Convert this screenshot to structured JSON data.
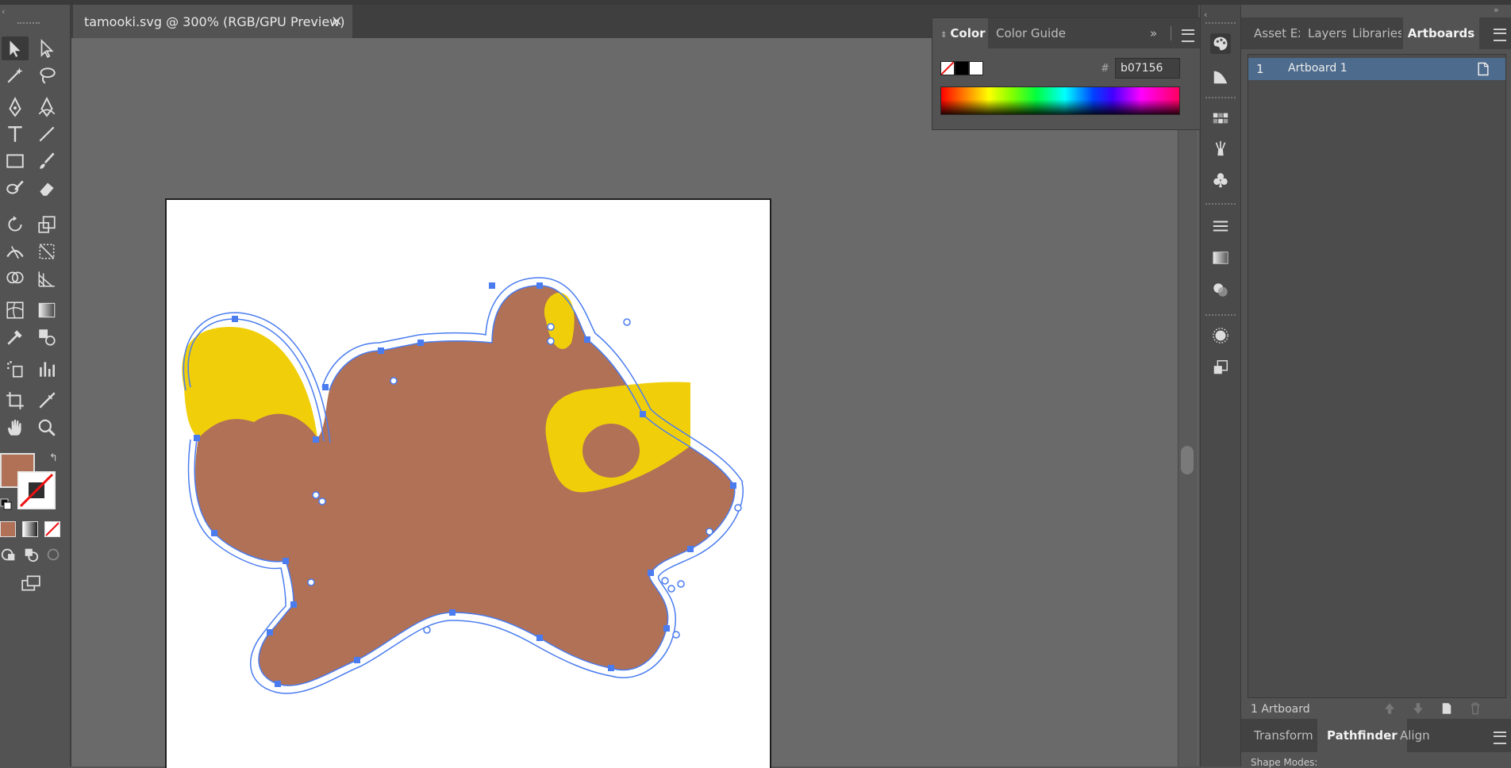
{
  "document": {
    "tab_title": "tamooki.svg @ 300% (RGB/GPU Preview)",
    "close_glyph": "×"
  },
  "color_panel": {
    "tabs": [
      "Color",
      "Color Guide"
    ],
    "hex_label": "#",
    "hex_value": "b07156",
    "expand_glyph": "»"
  },
  "right_panel": {
    "tabs": [
      "Asset Ex",
      "Layers",
      "Libraries",
      "Artboards"
    ],
    "artboards": [
      {
        "number": "1",
        "name": "Artboard 1"
      }
    ],
    "status": "1 Artboard",
    "bottom_tabs": [
      "Transform",
      "Pathfinder",
      "Align"
    ],
    "shape_modes_label": "Shape Modes:"
  },
  "colors": {
    "fill": "#b07156",
    "accent_yellow": "#f0cf0a",
    "selection_blue": "#4a7cf0",
    "artboard_row": "#4d6b8d"
  },
  "collapse_glyphs": {
    "left": "‹",
    "right": "»"
  }
}
